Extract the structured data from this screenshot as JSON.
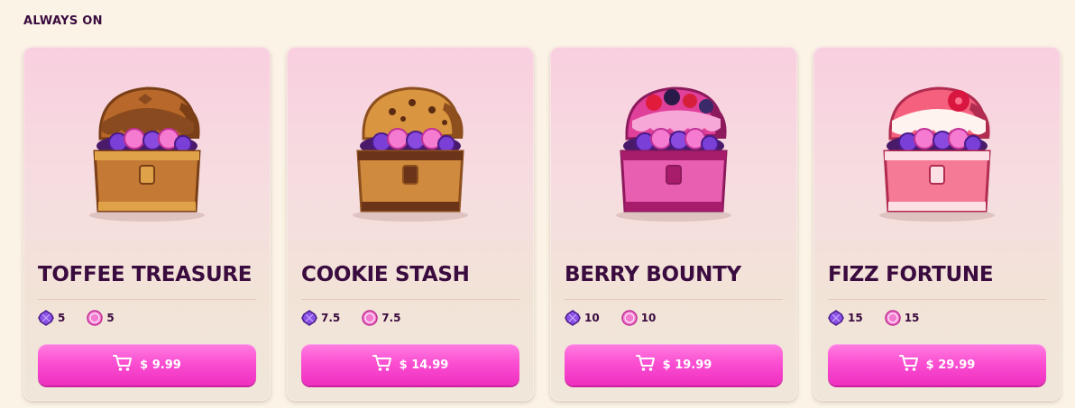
{
  "section": {
    "title": "ALWAYS ON"
  },
  "icons": {
    "cart": "shopping-cart-icon",
    "gem": "purple-gem-icon",
    "coin": "pink-coin-icon"
  },
  "colors": {
    "accent": "#fb4fd2",
    "title": "#3a0b3e",
    "background": "#fbf3e6"
  },
  "cards": [
    {
      "name": "TOFFEE TREASURE",
      "gems": "5",
      "coins": "5",
      "price": "$ 9.99",
      "art": {
        "lid": "#b8682a",
        "lid_dark": "#7a3f17",
        "body": "#c47a35",
        "trim": "#e0a248",
        "drip": "#8a4a1f",
        "topping": "toffee"
      }
    },
    {
      "name": "COOKIE STASH",
      "gems": "7.5",
      "coins": "7.5",
      "price": "$ 14.99",
      "art": {
        "lid": "#d9953f",
        "lid_dark": "#8d4f1e",
        "body": "#d08a3d",
        "trim": "#6b3418",
        "drip": "#5c2b12",
        "topping": "chips"
      }
    },
    {
      "name": "BERRY BOUNTY",
      "gems": "10",
      "coins": "10",
      "price": "$ 19.99",
      "art": {
        "lid": "#e0409a",
        "lid_dark": "#8e1a5e",
        "body": "#e85fb1",
        "trim": "#a81c6c",
        "drip": "#f7a6d8",
        "topping": "berries"
      }
    },
    {
      "name": "FIZZ FORTUNE",
      "gems": "15",
      "coins": "15",
      "price": "$ 29.99",
      "art": {
        "lid": "#f5607e",
        "lid_dark": "#b12c4f",
        "body": "#f47a96",
        "trim": "#fde0e6",
        "drip": "#fff3f0",
        "topping": "cream"
      }
    }
  ]
}
